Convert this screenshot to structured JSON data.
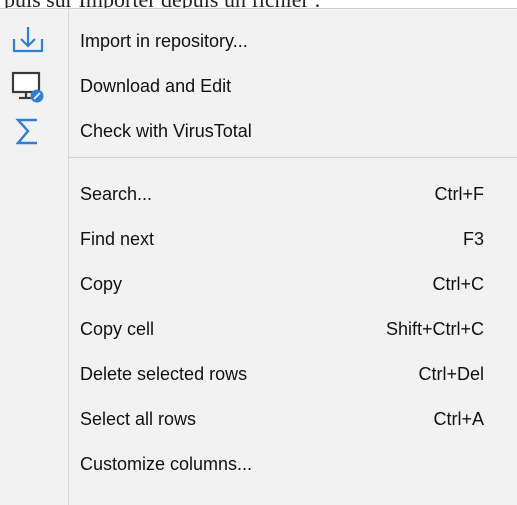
{
  "document_text": "puis sur Importer depuis un fichier :",
  "menu": {
    "group1": [
      {
        "label": "Import in repository...",
        "icon": "import-download-icon",
        "shortcut": ""
      },
      {
        "label": "Download and Edit",
        "icon": "monitor-edit-icon",
        "shortcut": ""
      },
      {
        "label": "Check with VirusTotal",
        "icon": "sigma-icon",
        "shortcut": ""
      }
    ],
    "group2": [
      {
        "label": "Search...",
        "shortcut": "Ctrl+F"
      },
      {
        "label": "Find next",
        "shortcut": "F3"
      },
      {
        "label": "Copy",
        "shortcut": "Ctrl+C"
      },
      {
        "label": "Copy cell",
        "shortcut": "Shift+Ctrl+C"
      },
      {
        "label": "Delete selected rows",
        "shortcut": "Ctrl+Del"
      },
      {
        "label": "Select all rows",
        "shortcut": "Ctrl+A"
      },
      {
        "label": "Customize columns...",
        "shortcut": ""
      }
    ]
  },
  "colors": {
    "menu_background": "#f2f2f2",
    "icon_blue": "#2f7fd8",
    "icon_dark": "#3a3a3a"
  }
}
